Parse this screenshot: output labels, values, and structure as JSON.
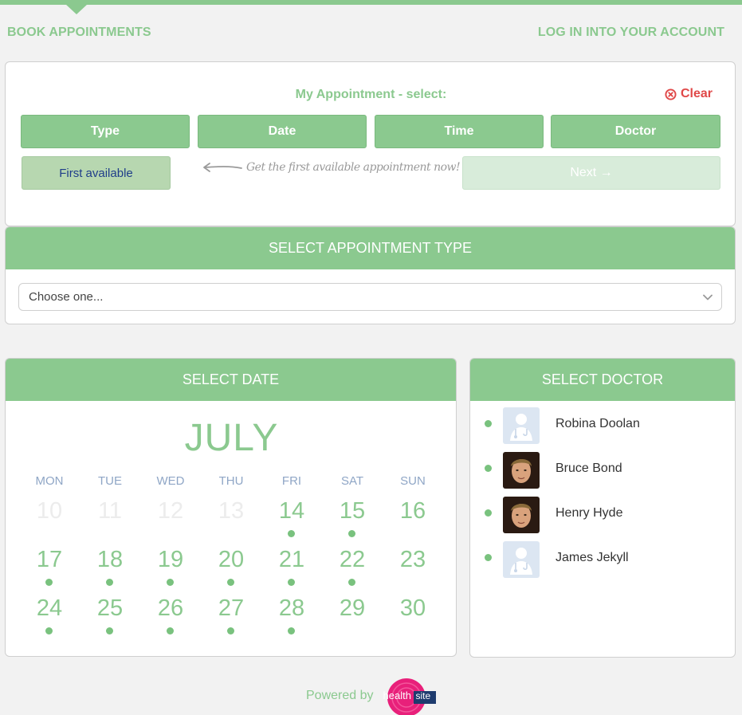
{
  "nav": {
    "book": "BOOK APPOINTMENTS",
    "login": "LOG IN INTO YOUR ACCOUNT"
  },
  "summary": {
    "title": "My Appointment - select:",
    "clear": "Clear",
    "steps": [
      "Type",
      "Date",
      "Time",
      "Doctor"
    ],
    "first_available": "First available",
    "hint": "Get the first available appointment now!",
    "next": "Next →"
  },
  "type_section": {
    "header": "SELECT APPOINTMENT TYPE",
    "select_value": "Choose one..."
  },
  "date_section": {
    "header": "SELECT DATE",
    "month": "JULY",
    "weekdays": [
      "MON",
      "TUE",
      "WED",
      "THU",
      "FRI",
      "SAT",
      "SUN"
    ],
    "weeks": [
      [
        {
          "d": "10",
          "on": false,
          "dot": false
        },
        {
          "d": "11",
          "on": false,
          "dot": false
        },
        {
          "d": "12",
          "on": false,
          "dot": false
        },
        {
          "d": "13",
          "on": false,
          "dot": false
        },
        {
          "d": "14",
          "on": true,
          "dot": true
        },
        {
          "d": "15",
          "on": true,
          "dot": true
        },
        {
          "d": "16",
          "on": true,
          "dot": false
        }
      ],
      [
        {
          "d": "17",
          "on": true,
          "dot": true
        },
        {
          "d": "18",
          "on": true,
          "dot": true
        },
        {
          "d": "19",
          "on": true,
          "dot": true
        },
        {
          "d": "20",
          "on": true,
          "dot": true
        },
        {
          "d": "21",
          "on": true,
          "dot": true
        },
        {
          "d": "22",
          "on": true,
          "dot": true
        },
        {
          "d": "23",
          "on": true,
          "dot": false
        }
      ],
      [
        {
          "d": "24",
          "on": true,
          "dot": true
        },
        {
          "d": "25",
          "on": true,
          "dot": true
        },
        {
          "d": "26",
          "on": true,
          "dot": true
        },
        {
          "d": "27",
          "on": true,
          "dot": true
        },
        {
          "d": "28",
          "on": true,
          "dot": true
        },
        {
          "d": "29",
          "on": true,
          "dot": false
        },
        {
          "d": "30",
          "on": true,
          "dot": false
        }
      ]
    ]
  },
  "doctor_section": {
    "header": "SELECT DOCTOR",
    "doctors": [
      {
        "name": "Robina Doolan",
        "avatar": "placeholder-doctor-icon"
      },
      {
        "name": "Bruce Bond",
        "avatar": "photo"
      },
      {
        "name": "Henry Hyde",
        "avatar": "photo"
      },
      {
        "name": "James Jekyll",
        "avatar": "placeholder-doctor-icon"
      }
    ]
  },
  "footer": {
    "powered_by": "Powered by",
    "logo_word1": "health",
    "logo_word2": "site"
  },
  "colors": {
    "accent": "#8bc98f",
    "clear": "#e04848",
    "first_available_bg": "#b7d7b0",
    "logo_pink": "#e8207a",
    "logo_navy": "#1e3b6e"
  }
}
